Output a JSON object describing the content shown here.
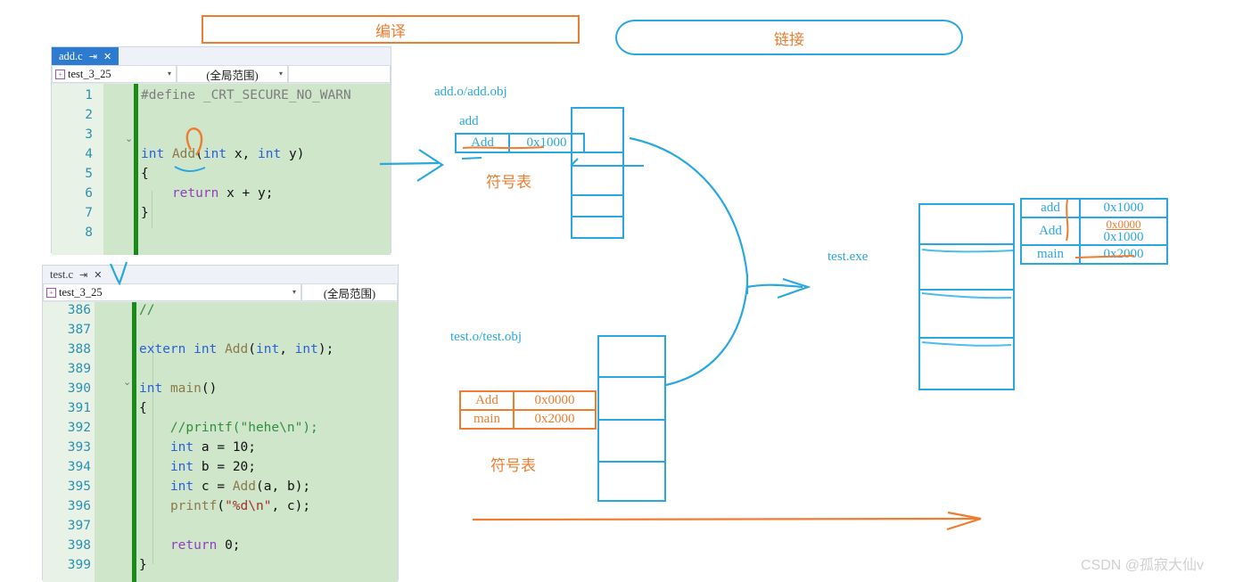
{
  "annotations": {
    "compile_label": "编译",
    "link_label": "链接"
  },
  "editor_add": {
    "tab_title": "add.c",
    "tab_pin_icon": "pin-icon",
    "tab_close_icon": "close-icon",
    "project_combo": "test_3_25",
    "scope_combo": "(全局范围)",
    "line_numbers": [
      "1",
      "2",
      "3",
      "4",
      "5",
      "6",
      "7",
      "8"
    ],
    "code_lines": [
      "#define _CRT_SECURE_NO_WARN",
      "",
      "",
      "int Add(int x, int y)",
      "{",
      "    return x + y;",
      "}",
      ""
    ]
  },
  "editor_test": {
    "tab_title": "test.c",
    "tab_pin_icon": "pin-icon",
    "tab_close_icon": "close-icon",
    "project_combo": "test_3_25",
    "scope_combo": "(全局范围)",
    "line_numbers": [
      "386",
      "387",
      "388",
      "389",
      "390",
      "391",
      "392",
      "393",
      "394",
      "395",
      "396",
      "397",
      "398",
      "399"
    ],
    "code_lines": [
      "//",
      "",
      "extern int Add(int, int);",
      "",
      "int main()",
      "{",
      "    //printf(\"hehe\\n\");",
      "    int a = 10;",
      "    int b = 20;",
      "    int c = Add(a, b);",
      "    printf(\"%d\\n\", c);",
      "",
      "    return 0;",
      "}"
    ]
  },
  "diagram": {
    "add_obj_label": "add.o/add.obj",
    "add_table_caption": "add",
    "add_symbol_rows": [
      {
        "name": "Add",
        "addr": "0x1000"
      }
    ],
    "add_symtab_label": "符号表",
    "test_obj_label": "test.o/test.obj",
    "test_symbol_rows": [
      {
        "name": "Add",
        "addr": "0x0000"
      },
      {
        "name": "main",
        "addr": "0x2000"
      }
    ],
    "test_symtab_label": "符号表",
    "exe_label": "test.exe",
    "final_symbol_rows": [
      {
        "name": "add",
        "addr": "0x1000",
        "corrected": ""
      },
      {
        "name": "Add",
        "addr": "0x1000",
        "corrected": "0x0000"
      },
      {
        "name": "main",
        "addr": "0x2000",
        "corrected": ""
      }
    ]
  },
  "colors": {
    "blue": "#29a8e0",
    "orange": "#ed7d31",
    "code_bg": "#cfe6cb",
    "tab_active": "#2d7bd0"
  },
  "watermark": "CSDN @孤寂大仙v"
}
